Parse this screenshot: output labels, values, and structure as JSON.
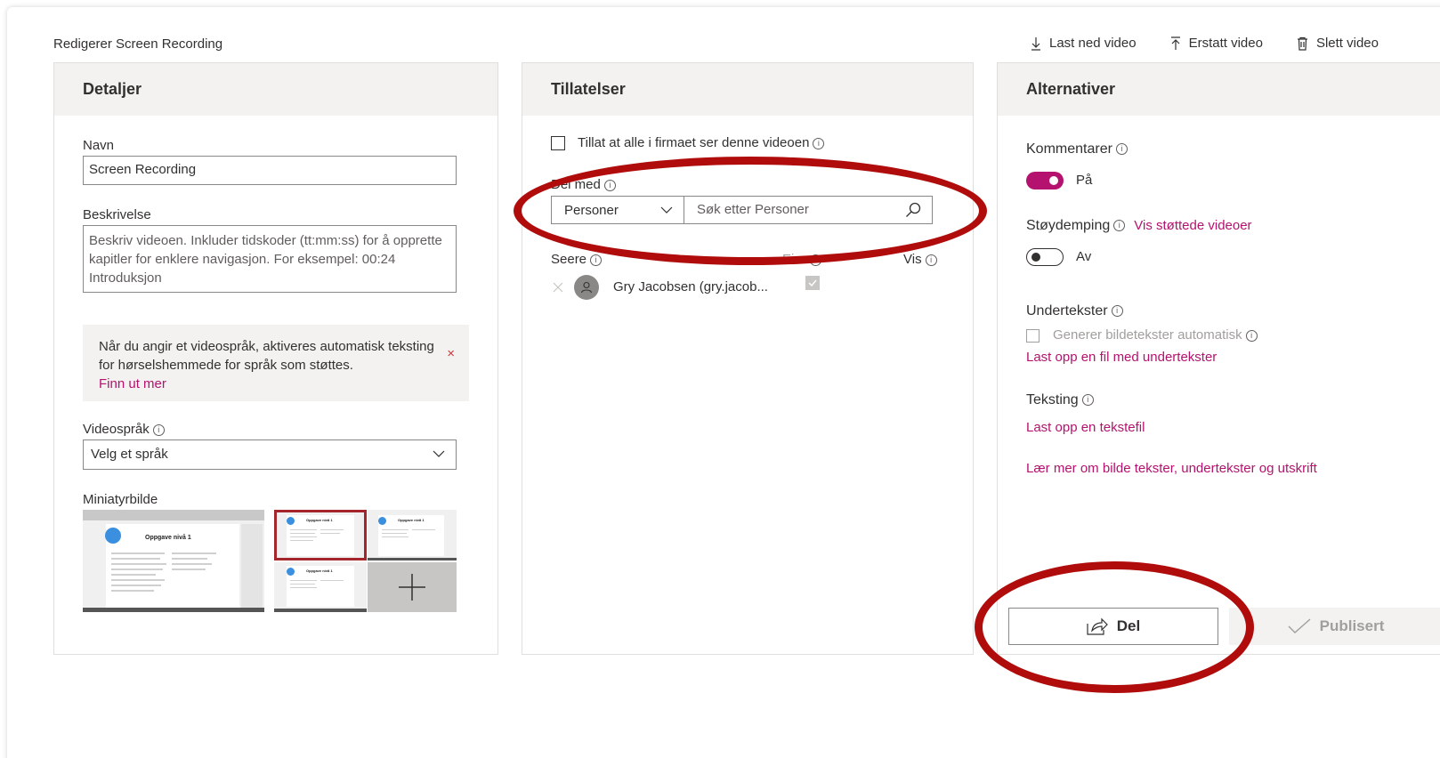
{
  "page": {
    "title": "Redigerer Screen Recording"
  },
  "toolbar": {
    "download": "Last ned video",
    "replace": "Erstatt video",
    "delete": "Slett video"
  },
  "details": {
    "header": "Detaljer",
    "name_label": "Navn",
    "name_value": "Screen Recording",
    "description_label": "Beskrivelse",
    "description_placeholder": "Beskriv videoen. Inkluder tidskoder (tt:mm:ss) for å opprette kapitler for enklere navigasjon. For eksempel: 00:24 Introduksjon",
    "notice_text": "Når du angir et videospråk, aktiveres automatisk teksting for hørselshemmede for språk som støttes.",
    "notice_link": "Finn ut mer",
    "notice_close": "×",
    "language_label": "Videospråk",
    "language_value": "Velg et språk",
    "thumbnail_label": "Miniatyrbilde",
    "thumbnails": [
      {
        "caption": "Oppgave nivå 1"
      },
      {
        "caption": "Oppgave nivå 1"
      },
      {
        "caption": "Oppgave nivå 1"
      },
      {
        "caption": "Oppgave nivå 1"
      }
    ]
  },
  "permissions": {
    "header": "Tillatelser",
    "allow_company_label": "Tillat at alle i firmaet ser denne videoen",
    "share_with_label": "Del med",
    "scope_value": "Personer",
    "search_placeholder": "Søk etter Personer",
    "viewers_label": "Seere",
    "owner_label": "Eier",
    "view_label": "Vis",
    "viewer_name": "Gry Jacobsen (gry.jacob..."
  },
  "options": {
    "header": "Alternativer",
    "comments_label": "Kommentarer",
    "comments_state": "På",
    "noise_label": "Støydemping",
    "noise_link": "Vis støttede videoer",
    "noise_state": "Av",
    "subtitles_label": "Undertekster",
    "auto_captions_label": "Generer bildetekster automatisk",
    "upload_subtitles_link": "Last opp en fil med undertekster",
    "transcript_label": "Teksting",
    "upload_transcript_link": "Last opp en tekstefil",
    "learn_more_link": "Lær mer om bilde tekster, undertekster og utskrift",
    "share_button": "Del",
    "publish_button": "Publisert"
  },
  "colors": {
    "accent": "#b4126e",
    "annotation": "#b00c0c",
    "header_bg": "#f3f2f1"
  }
}
